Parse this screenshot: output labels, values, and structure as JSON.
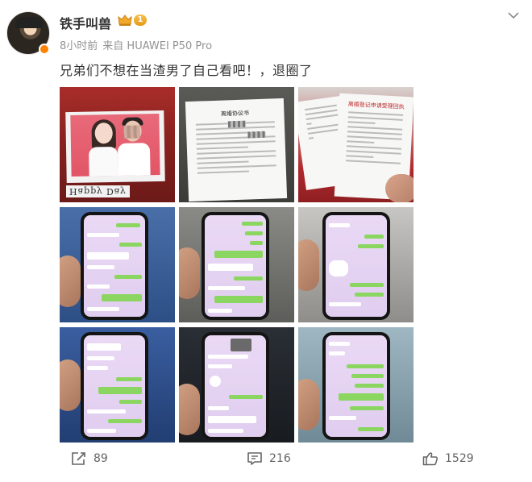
{
  "post": {
    "author": {
      "name": "铁手叫兽",
      "level": "1"
    },
    "meta": {
      "time": "8小时前",
      "source": "来自 HUAWEI P50 Pro"
    },
    "text": "兄弟们不想在当渣男了自己看吧！，退圈了",
    "images": [
      {
        "caption": "Happy Day"
      },
      {
        "doc_title": "离婚协议书"
      },
      {
        "doc_title": "离婚登记申请受理回执"
      }
    ]
  },
  "actions": {
    "repost": {
      "count": "89",
      "icon": "repost-icon"
    },
    "comment": {
      "count": "216",
      "icon": "comment-icon"
    },
    "like": {
      "count": "1529",
      "icon": "thumbs-up-icon"
    }
  },
  "colors": {
    "text": "#333333",
    "meta": "#939393",
    "action": "#636363",
    "chat_bg": "#e6d4f2",
    "chat_green": "#8bd660",
    "badge": "#f0a92a"
  }
}
